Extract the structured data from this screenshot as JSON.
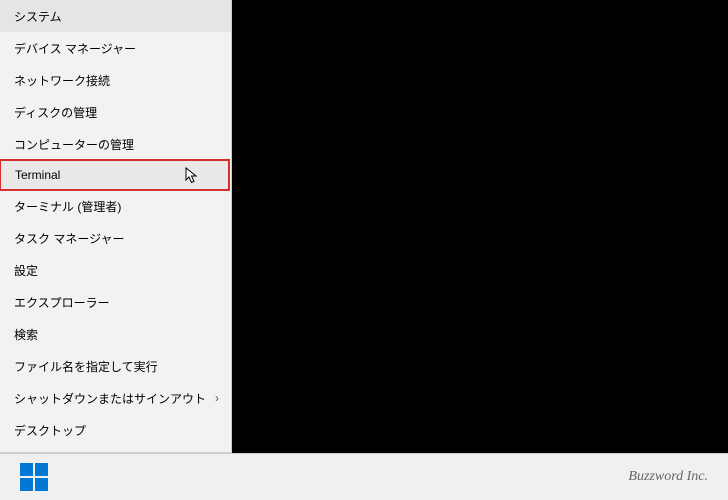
{
  "menu": {
    "items": [
      {
        "label": "システム",
        "hasExpand": false
      },
      {
        "label": "デバイス マネージャー",
        "hasExpand": false
      },
      {
        "label": "ネットワーク接続",
        "hasExpand": false
      },
      {
        "label": "ディスクの管理",
        "hasExpand": false
      },
      {
        "label": "コンピューターの管理",
        "hasExpand": false
      },
      {
        "label": "Terminal",
        "hasExpand": false,
        "highlighted": true
      },
      {
        "label": "ターミナル (管理者)",
        "hasExpand": false
      },
      {
        "label": "タスク マネージャー",
        "hasExpand": false
      },
      {
        "label": "設定",
        "hasExpand": false
      },
      {
        "label": "エクスプローラー",
        "hasExpand": false
      },
      {
        "label": "検索",
        "hasExpand": false
      },
      {
        "label": "ファイル名を指定して実行",
        "hasExpand": false
      },
      {
        "label": "シャットダウンまたはサインアウト",
        "hasExpand": true
      },
      {
        "label": "デスクトップ",
        "hasExpand": false
      }
    ],
    "expandGlyph": "›"
  },
  "taskbar": {
    "brand": "Buzzword Inc."
  }
}
